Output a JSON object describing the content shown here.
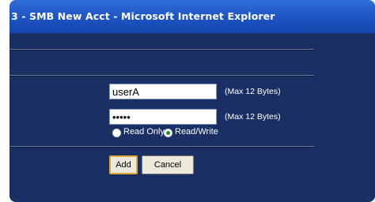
{
  "window": {
    "title": "3 - SMB New Acct - Microsoft Internet Explorer"
  },
  "form": {
    "username": {
      "value": "userA",
      "hint": "(Max 12 Bytes)"
    },
    "password": {
      "value": "userA",
      "hint": "(Max 12 Bytes)"
    },
    "access": {
      "options": [
        {
          "label": "Read Only",
          "checked": false
        },
        {
          "label": "Read/Write",
          "checked": true
        }
      ]
    },
    "buttons": {
      "add": "Add",
      "cancel": "Cancel"
    }
  }
}
